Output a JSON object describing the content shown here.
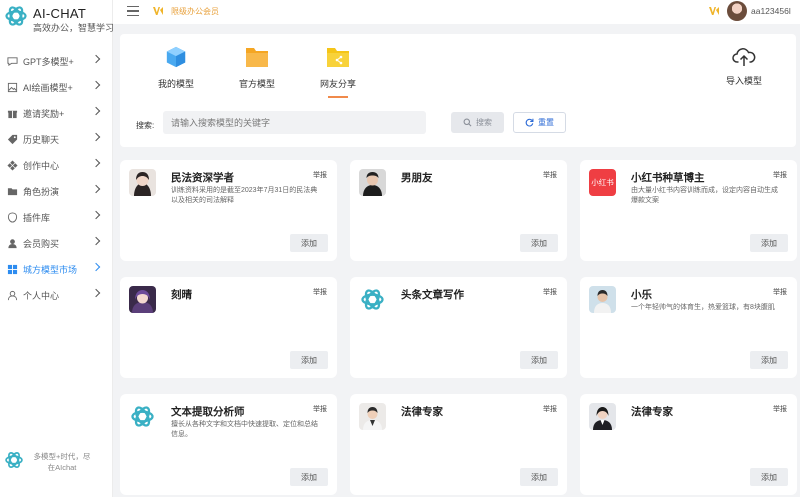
{
  "app": {
    "title": "AI-CHAT",
    "subtitle": "高效办公，智慧学习",
    "footer_text": "多模型+时代，尽在AIchat"
  },
  "sidebar": {
    "items": [
      {
        "label": "GPT多模型+",
        "icon": "chat-bubble-icon"
      },
      {
        "label": "AI绘画模型+",
        "icon": "image-icon"
      },
      {
        "label": "邀请奖励+",
        "icon": "gift-icon"
      },
      {
        "label": "历史聊天",
        "icon": "tag-icon"
      },
      {
        "label": "创作中心",
        "icon": "grid-icon"
      },
      {
        "label": "角色扮演",
        "icon": "folder-icon"
      },
      {
        "label": "插件库",
        "icon": "plugin-icon"
      },
      {
        "label": "会员购买",
        "icon": "member-icon"
      },
      {
        "label": "城方模型市场",
        "icon": "market-icon",
        "active": true
      },
      {
        "label": "个人中心",
        "icon": "user-icon"
      }
    ],
    "active_color": "#2d8cf0"
  },
  "topbar": {
    "vip_text": "限级办公会员",
    "username": "aa123456l"
  },
  "tabs": [
    {
      "label": "我的模型",
      "icon": "cube-icon"
    },
    {
      "label": "官方模型",
      "icon": "folder-icon"
    },
    {
      "label": "网友分享",
      "icon": "share-folder-icon",
      "active": true
    }
  ],
  "import_label": "导入模型",
  "search": {
    "label": "搜索:",
    "placeholder": "请输入搜索模型的关键字",
    "search_button": "搜索",
    "reset_button": "重置"
  },
  "cards": [
    {
      "name": "民法资深学者",
      "report": "举报",
      "desc": "训练资料采用的是截至2023年7月31日的民法典以及相关的司法解释",
      "add": "添加",
      "avatar": "woman-photo"
    },
    {
      "name": "男朋友",
      "report": "举报",
      "desc": "",
      "add": "添加",
      "avatar": "man-photo"
    },
    {
      "name": "小红书种草博主",
      "report": "举报",
      "desc": "由大量小红书内容训练而成，设定内容自动生成爆款文案",
      "add": "添加",
      "avatar": "xiaohongshu",
      "avatar_text": "小红书"
    },
    {
      "name": "刻晴",
      "report": "举报",
      "desc": "",
      "add": "添加",
      "avatar": "anime-girl"
    },
    {
      "name": "头条文章写作",
      "report": "举报",
      "desc": "",
      "add": "添加",
      "avatar": "openai-logo"
    },
    {
      "name": "小乐",
      "report": "举报",
      "desc": "一个年轻帅气的体育生，热爱篮球，有8块腹肌",
      "add": "添加",
      "avatar": "boy-photo"
    },
    {
      "name": "文本提取分析师",
      "report": "举报",
      "desc": "擅长从各种文字和文档中快速提取、定位和总结信息。",
      "add": "添加",
      "avatar": "openai-logo"
    },
    {
      "name": "法律专家",
      "report": "举报",
      "desc": "",
      "add": "添加",
      "avatar": "man-suit-photo"
    },
    {
      "name": "法律专家",
      "report": "举报",
      "desc": "",
      "add": "添加",
      "avatar": "woman-suit-photo"
    }
  ]
}
